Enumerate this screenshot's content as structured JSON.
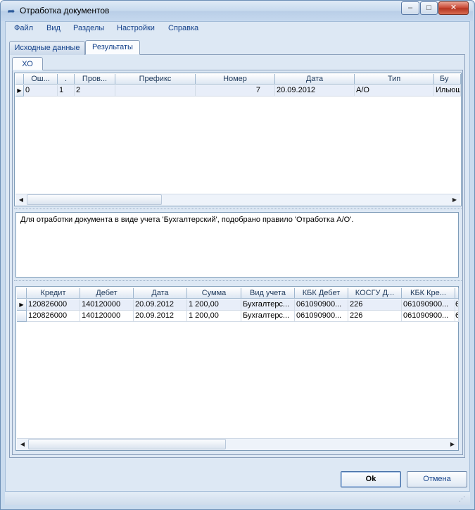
{
  "window": {
    "title": "Отработка документов"
  },
  "menu": [
    "Файл",
    "Вид",
    "Разделы",
    "Настройки",
    "Справка"
  ],
  "tabs": {
    "source": "Исходные данные",
    "results": "Результаты",
    "inner": "ХО"
  },
  "grid1": {
    "columns": [
      "Ош...",
      ".",
      "Пров...",
      "Префикс",
      "Номер",
      "Дата",
      "Тип",
      "Бу"
    ],
    "rows": [
      [
        "0",
        "1",
        "2",
        "",
        "7",
        "20.09.2012",
        "А/О",
        "Ильюш"
      ]
    ]
  },
  "message": "Для отработки документа в виде учета 'Бухгалтерский', подобрано правило 'Отработка А/О'.",
  "grid2": {
    "columns": [
      "Кредит",
      "Дебет",
      "Дата",
      "Сумма",
      "Вид учета",
      "КБК Дебет",
      "КОСГУ Д...",
      "КБК Кре..."
    ],
    "rows": [
      [
        "120826000",
        "140120000",
        "20.09.2012",
        "1 200,00",
        "Бухгалтерс...",
        "061090900...",
        "226",
        "061090900...",
        "6"
      ],
      [
        "120826000",
        "140120000",
        "20.09.2012",
        "1 200,00",
        "Бухгалтерс...",
        "061090900...",
        "226",
        "061090900...",
        "6"
      ]
    ]
  },
  "buttons": {
    "ok": "Ok",
    "cancel": "Отмена"
  },
  "icons": {
    "app": "document-arrow-icon",
    "minimize": "minimize-icon",
    "maximize": "maximize-icon",
    "close": "close-icon"
  },
  "colors": {
    "accent": "#15428b",
    "frame": "#dde8f4"
  }
}
